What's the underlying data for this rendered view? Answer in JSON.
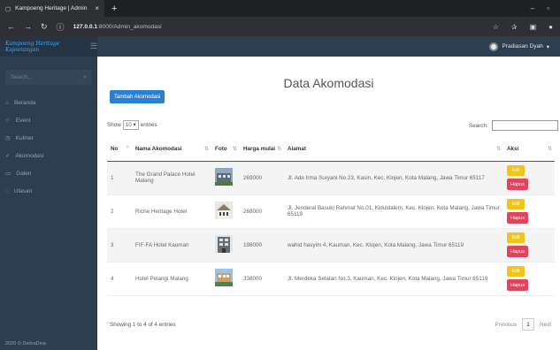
{
  "browser": {
    "tab_title": "Kampoeng Heritage | Admin",
    "url_host": "127.0.0.1",
    "url_rest": ":8000/Admin_akomodasi"
  },
  "header": {
    "brand": "Kampoeng Heritage Kajoetangan",
    "user_name": "Pradiasan Dyah"
  },
  "sidebar": {
    "search_placeholder": "Search...",
    "items": [
      {
        "label": "Beranda",
        "icon": "home-icon"
      },
      {
        "label": "Event",
        "icon": "star-icon"
      },
      {
        "label": "Kuliner",
        "icon": "food-icon"
      },
      {
        "label": "Akomodasi",
        "icon": "check-icon"
      },
      {
        "label": "Galeri",
        "icon": "image-icon"
      },
      {
        "label": "Ulasan",
        "icon": "comment-icon"
      }
    ],
    "footer": "2020 © DelivaDina"
  },
  "main": {
    "title": "Data Akomodasi",
    "add_button": "Tambah Akomodasi",
    "show_label": "Show",
    "show_value": "10",
    "entries_label": "entries",
    "search_label": "Search:",
    "columns": [
      "No",
      "Nama Akomodasi",
      "Foto",
      "Harga mulai",
      "Alamat",
      "Aksi"
    ],
    "rows": [
      {
        "no": "1",
        "nama": "The Grand Palace Hotel Malang",
        "harga": "269000",
        "alamat": "Jl. Ade Irma Suryani No.23, Kasin, Kec. Klojen, Kota Malang, Jawa Timur 65117"
      },
      {
        "no": "2",
        "nama": "Riche Heritage Hotel",
        "harga": "268000",
        "alamat": "Jl. Jenderal Basuki Rahmat No.01, Kiduldalem, Kec. Klojen, Kota Malang, Jawa Timur 65119"
      },
      {
        "no": "3",
        "nama": "FIF-FA Hotel Kauman",
        "harga": "198000",
        "alamat": "wahid hasyim 4, Kauman, Kec. Klojen, Kota Malang, Jawa Timur 65119"
      },
      {
        "no": "4",
        "nama": "Hotel Pelangi Malang",
        "harga": "338000",
        "alamat": "Jl. Merdeka Selatan No.3, Kauman, Kec. Klojen, Kota Malang, Jawa Timur 65119"
      }
    ],
    "edit_label": "Edit",
    "delete_label": "Hapus",
    "showing_text": "Showing 1 to 4 of 4 entries",
    "pager": {
      "previous": "Previous",
      "page": "1",
      "next": "Next"
    }
  },
  "colors": {
    "sidebar": "#2d3e50",
    "primary": "#2a80d0",
    "edit": "#f0c419",
    "delete": "#e0455f"
  }
}
